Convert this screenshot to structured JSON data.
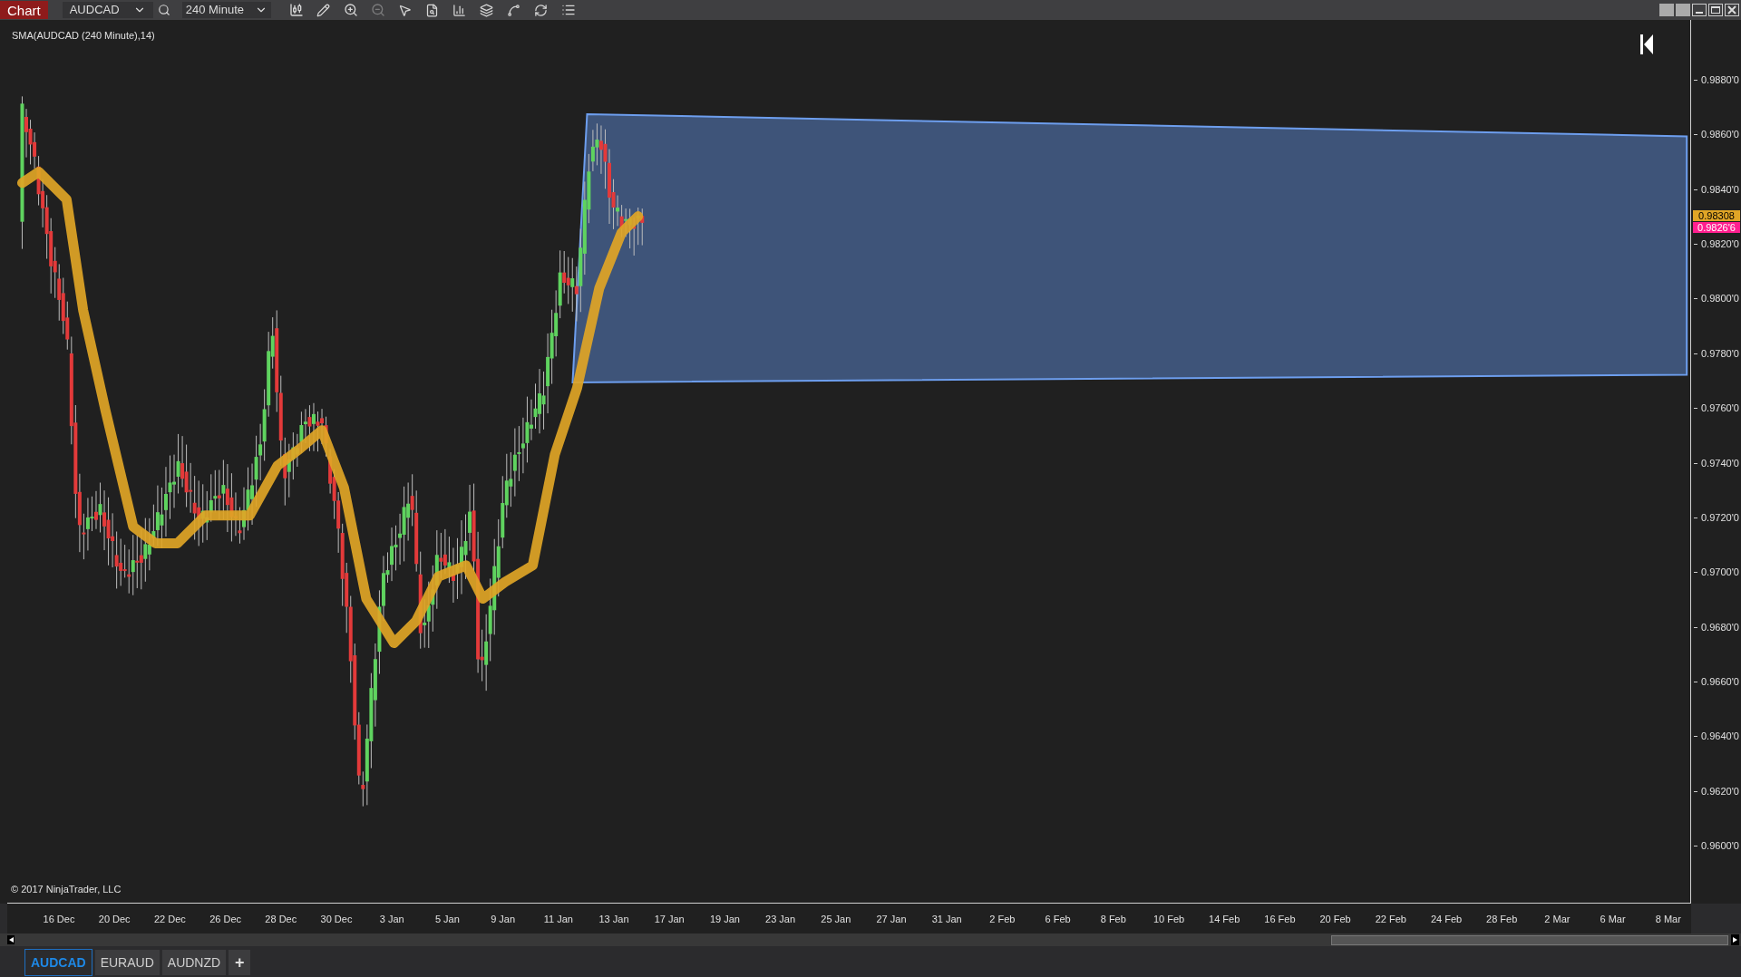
{
  "toolbar": {
    "title": "Chart",
    "instrument": "AUDCAD",
    "interval": "240 Minute"
  },
  "indicator_label": "SMA(AUDCAD (240 Minute),14)",
  "copyright": "© 2017 NinjaTrader, LLC",
  "price_axis": {
    "labels": [
      "0.9880'0",
      "0.9860'0",
      "0.9840'0",
      "0.9820'0",
      "0.9800'0",
      "0.9780'0",
      "0.9760'0",
      "0.9740'0",
      "0.9720'0",
      "0.9700'0",
      "0.9680'0",
      "0.9660'0",
      "0.9640'0",
      "0.9620'0",
      "0.9600'0"
    ],
    "markers": [
      {
        "text": "0.98308",
        "color": "#e0a526"
      },
      {
        "text": "0.9826'6",
        "color": "#ff1f8f"
      }
    ]
  },
  "time_axis": {
    "labels": [
      "16 Dec",
      "20 Dec",
      "22 Dec",
      "26 Dec",
      "28 Dec",
      "30 Dec",
      "3 Jan",
      "5 Jan",
      "9 Jan",
      "11 Jan",
      "13 Jan",
      "17 Jan",
      "19 Jan",
      "23 Jan",
      "25 Jan",
      "27 Jan",
      "31 Jan",
      "2 Feb",
      "6 Feb",
      "8 Feb",
      "10 Feb",
      "14 Feb",
      "16 Feb",
      "20 Feb",
      "22 Feb",
      "24 Feb",
      "28 Feb",
      "2 Mar",
      "6 Mar",
      "8 Mar"
    ]
  },
  "tabs": [
    {
      "label": "AUDCAD",
      "selected": true
    },
    {
      "label": "EURAUD",
      "selected": false
    },
    {
      "label": "AUDNZD",
      "selected": false
    }
  ],
  "add_tab": "+"
}
